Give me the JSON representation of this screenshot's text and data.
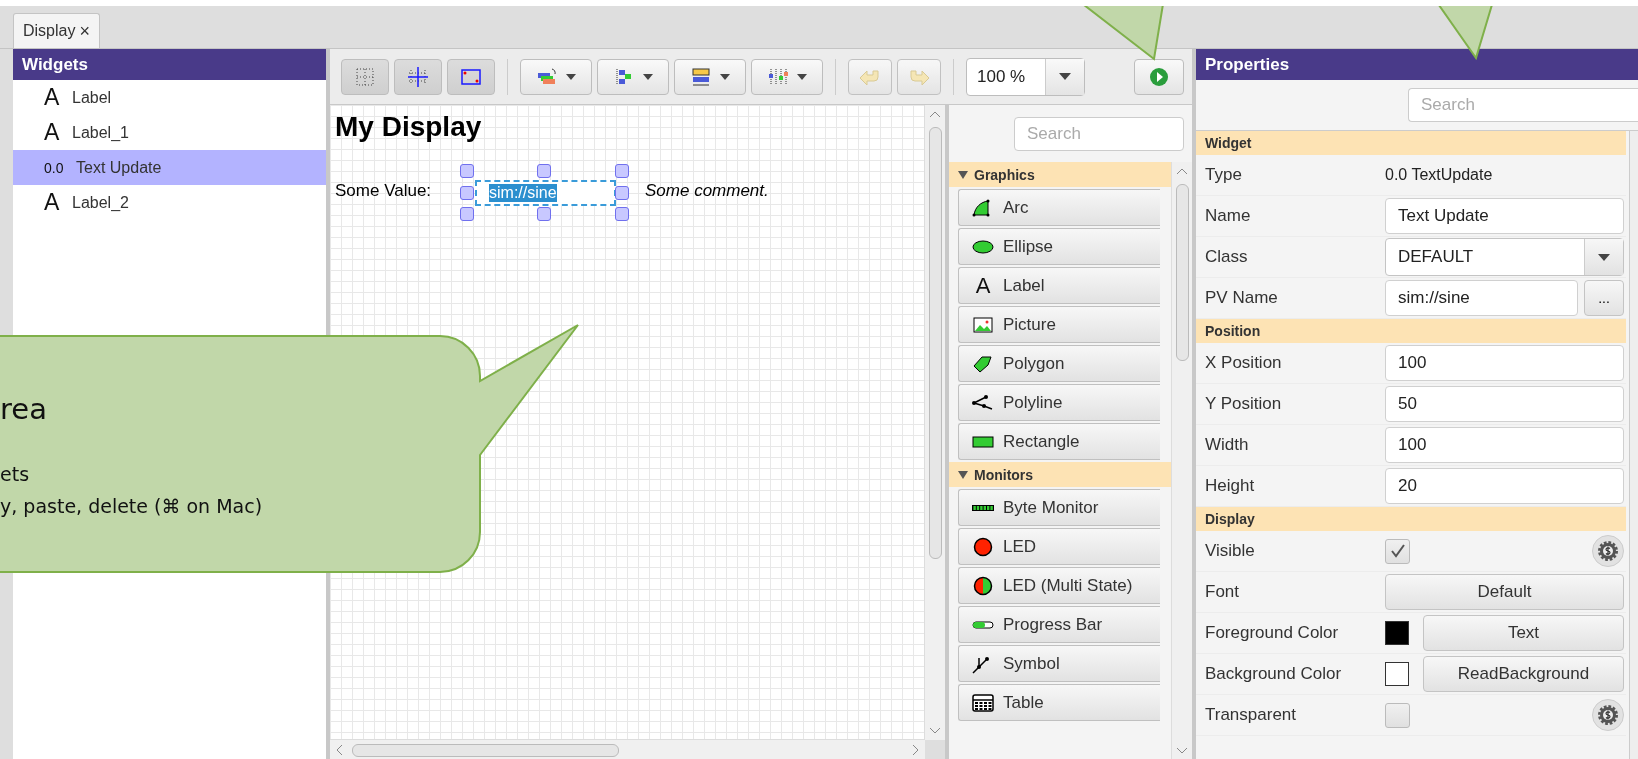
{
  "tabs": [
    {
      "label": "Display",
      "close": "×",
      "selected": true
    }
  ],
  "widgets_panel": {
    "title": "Widgets",
    "items": [
      {
        "icon": "A",
        "label": "Label",
        "selected": false
      },
      {
        "icon": "A",
        "label": "Label_1",
        "selected": false
      },
      {
        "icon": "0.0",
        "label": "Text Update",
        "selected": true
      },
      {
        "icon": "A",
        "label": "Label_2",
        "selected": false
      }
    ]
  },
  "toolbar": {
    "toggles": [
      {
        "kind": "grid"
      },
      {
        "kind": "snap"
      },
      {
        "kind": "coords"
      }
    ],
    "menus": [
      {
        "kind": "order"
      },
      {
        "kind": "align"
      },
      {
        "kind": "size"
      },
      {
        "kind": "distribute"
      }
    ],
    "zoom": "100 %"
  },
  "canvas": {
    "title": "My Display",
    "value_label": "Some Value:",
    "pv": "sim://sine",
    "comment": "Some comment."
  },
  "palette": {
    "search_placeholder": "Search",
    "groups": [
      {
        "name": "Graphics",
        "expanded": true,
        "items": [
          {
            "kind": "arc",
            "label": "Arc"
          },
          {
            "kind": "ellipse",
            "label": "Ellipse"
          },
          {
            "kind": "label",
            "glyph": "A",
            "label": "Label"
          },
          {
            "kind": "picture",
            "label": "Picture"
          },
          {
            "kind": "polygon",
            "label": "Polygon"
          },
          {
            "kind": "polyline",
            "label": "Polyline"
          },
          {
            "kind": "rectangle",
            "label": "Rectangle"
          }
        ]
      },
      {
        "name": "Monitors",
        "expanded": true,
        "items": [
          {
            "kind": "byte",
            "label": "Byte Monitor"
          },
          {
            "kind": "led",
            "label": "LED"
          },
          {
            "kind": "multiled",
            "label": "LED (Multi State)"
          },
          {
            "kind": "progress",
            "label": "Progress Bar"
          },
          {
            "kind": "symbol",
            "label": "Symbol"
          },
          {
            "kind": "table",
            "label": "Table"
          }
        ]
      }
    ]
  },
  "properties": {
    "title": "Properties",
    "search_placeholder": "Search",
    "sections": [
      {
        "name": "Widget",
        "rows": [
          {
            "kind": "text",
            "label": "Type",
            "value": "0.0 TextUpdate"
          },
          {
            "kind": "field",
            "label": "Name",
            "value": "Text Update"
          },
          {
            "kind": "combo",
            "label": "Class",
            "value": "DEFAULT"
          },
          {
            "kind": "field_button",
            "label": "PV Name",
            "value": "sim://sine",
            "button": "..."
          }
        ]
      },
      {
        "name": "Position",
        "rows": [
          {
            "kind": "field",
            "label": "X Position",
            "value": "100"
          },
          {
            "kind": "field",
            "label": "Y Position",
            "value": "50"
          },
          {
            "kind": "field",
            "label": "Width",
            "value": "100"
          },
          {
            "kind": "field",
            "label": "Height",
            "value": "20"
          }
        ]
      },
      {
        "name": "Display",
        "rows": [
          {
            "kind": "checkbox",
            "label": "Visible",
            "checked": true,
            "rule": true
          },
          {
            "kind": "button",
            "label": "Font",
            "value": "Default"
          },
          {
            "kind": "color",
            "label": "Foreground Color",
            "color": "#000000",
            "value": "Text"
          },
          {
            "kind": "color",
            "label": "Background Color",
            "color": "#ffffff",
            "value": "ReadBackground"
          },
          {
            "kind": "checkbox",
            "label": "Transparent",
            "checked": false,
            "rule": true
          }
        ]
      }
    ]
  },
  "callout": {
    "title": "rea",
    "lines": [
      "ets",
      "y, paste, delete (⌘ on Mac)"
    ]
  }
}
